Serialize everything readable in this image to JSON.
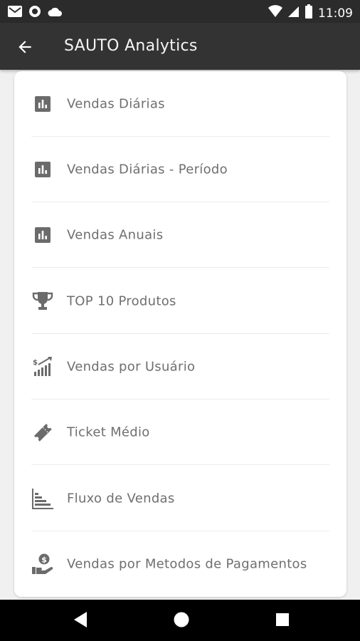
{
  "statusbar": {
    "time": "11:09",
    "icons_left": [
      "gmail-icon",
      "circle-app-icon",
      "cloud-icon"
    ],
    "icons_right": [
      "wifi-icon",
      "signal-icon",
      "battery-icon"
    ]
  },
  "appbar": {
    "title": "SAUTO Analytics",
    "back_icon": "arrow-back-icon"
  },
  "menu": {
    "items": [
      {
        "label": "Vendas Diárias",
        "icon": "bar-chart-icon"
      },
      {
        "label": "Vendas Diárias - Período",
        "icon": "bar-chart-icon"
      },
      {
        "label": "Vendas Anuais",
        "icon": "bar-chart-icon"
      },
      {
        "label": "TOP 10 Produtos",
        "icon": "trophy-icon"
      },
      {
        "label": "Vendas por Usuário",
        "icon": "sales-growth-icon"
      },
      {
        "label": "Ticket Médio",
        "icon": "ticket-icon"
      },
      {
        "label": "Fluxo de Vendas",
        "icon": "flow-chart-icon"
      },
      {
        "label": "Vendas por Metodos de Pagamentos",
        "icon": "hand-money-icon"
      }
    ]
  },
  "colors": {
    "statusbar": "#2b2b2b",
    "appbar": "#333333",
    "icon": "#6b6b6b",
    "label": "#6f6f6f",
    "navbar": "#000000"
  },
  "navbar": {
    "buttons": [
      "back-triangle-icon",
      "home-circle-icon",
      "recents-square-icon"
    ]
  }
}
